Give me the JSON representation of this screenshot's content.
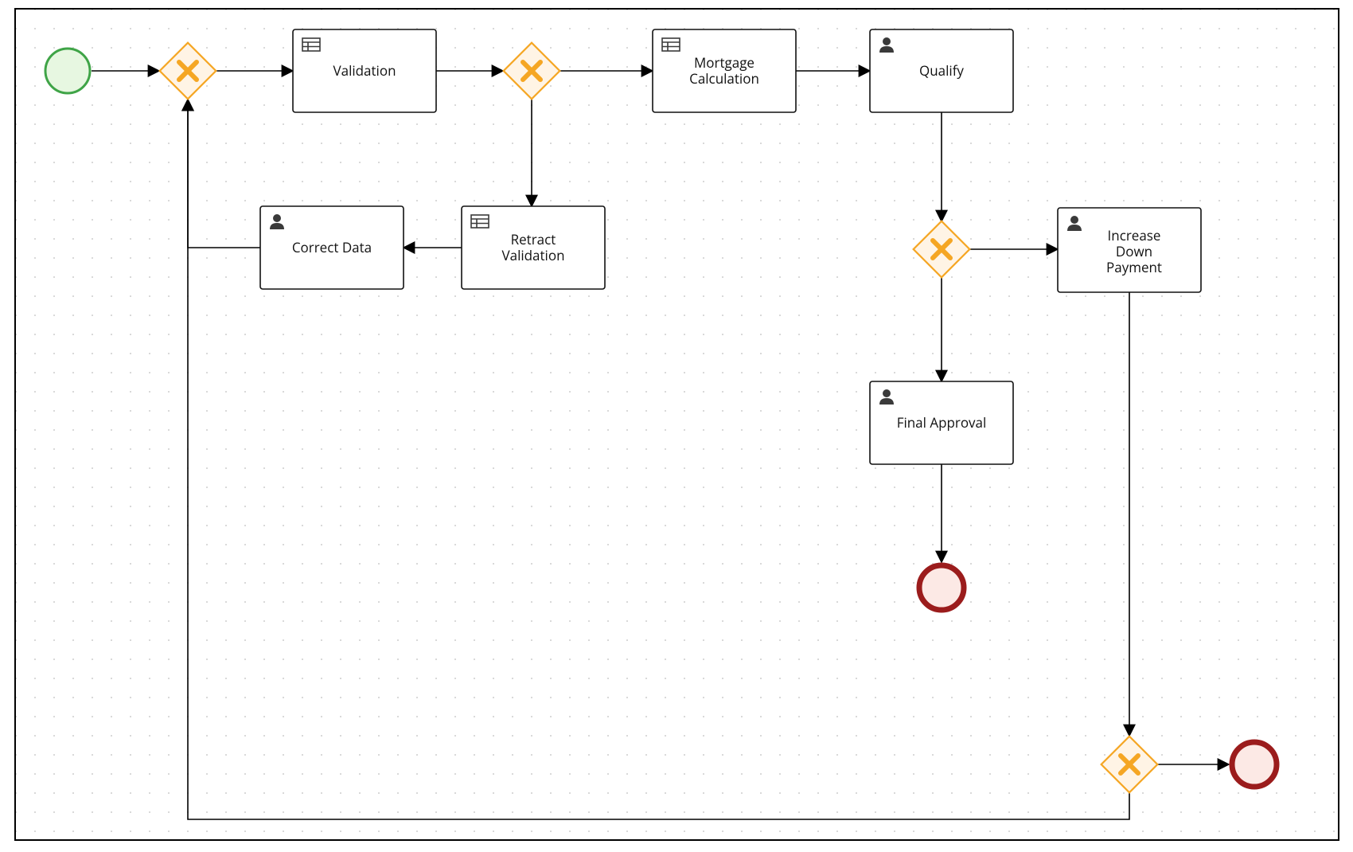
{
  "chart_data": {
    "type": "bpmn-diagram",
    "events": {
      "start": {
        "kind": "start"
      },
      "end1": {
        "kind": "end"
      },
      "end2": {
        "kind": "end"
      }
    },
    "gateways": {
      "g1": {
        "kind": "exclusive"
      },
      "g2": {
        "kind": "exclusive"
      },
      "g3": {
        "kind": "exclusive"
      },
      "g4": {
        "kind": "exclusive"
      }
    },
    "tasks": {
      "validation": {
        "label": "Validation",
        "icon": "business-rule"
      },
      "mortgage_calc": {
        "label": "Mortgage Calculation",
        "icon": "business-rule"
      },
      "qualify": {
        "label": "Qualify",
        "icon": "user"
      },
      "retract": {
        "label": "Retract Validation",
        "icon": "business-rule"
      },
      "correct": {
        "label": "Correct Data",
        "icon": "user"
      },
      "increase": {
        "label": "Increase Down Payment",
        "icon": "user"
      },
      "final_approval": {
        "label": "Final Approval",
        "icon": "user"
      }
    },
    "flows": [
      {
        "from": "start",
        "to": "g1"
      },
      {
        "from": "g1",
        "to": "validation"
      },
      {
        "from": "validation",
        "to": "g2"
      },
      {
        "from": "g2",
        "to": "mortgage_calc"
      },
      {
        "from": "mortgage_calc",
        "to": "qualify"
      },
      {
        "from": "g2",
        "to": "retract"
      },
      {
        "from": "retract",
        "to": "correct"
      },
      {
        "from": "correct",
        "to": "g1"
      },
      {
        "from": "qualify",
        "to": "g3"
      },
      {
        "from": "g3",
        "to": "increase"
      },
      {
        "from": "g3",
        "to": "final_approval"
      },
      {
        "from": "final_approval",
        "to": "end1"
      },
      {
        "from": "increase",
        "to": "g4"
      },
      {
        "from": "g4",
        "to": "end2"
      },
      {
        "from": "g4",
        "to": "g1"
      }
    ]
  },
  "tasks": {
    "validation": {
      "label": "Validation"
    },
    "mortgage_calc_l1": "Mortgage",
    "mortgage_calc_l2": "Calculation",
    "qualify": {
      "label": "Qualify"
    },
    "retract_l1": "Retract",
    "retract_l2": "Validation",
    "correct": {
      "label": "Correct Data"
    },
    "increase_l1": "Increase",
    "increase_l2": "Down",
    "increase_l3": "Payment",
    "final_approval": {
      "label": "Final Approval"
    }
  }
}
